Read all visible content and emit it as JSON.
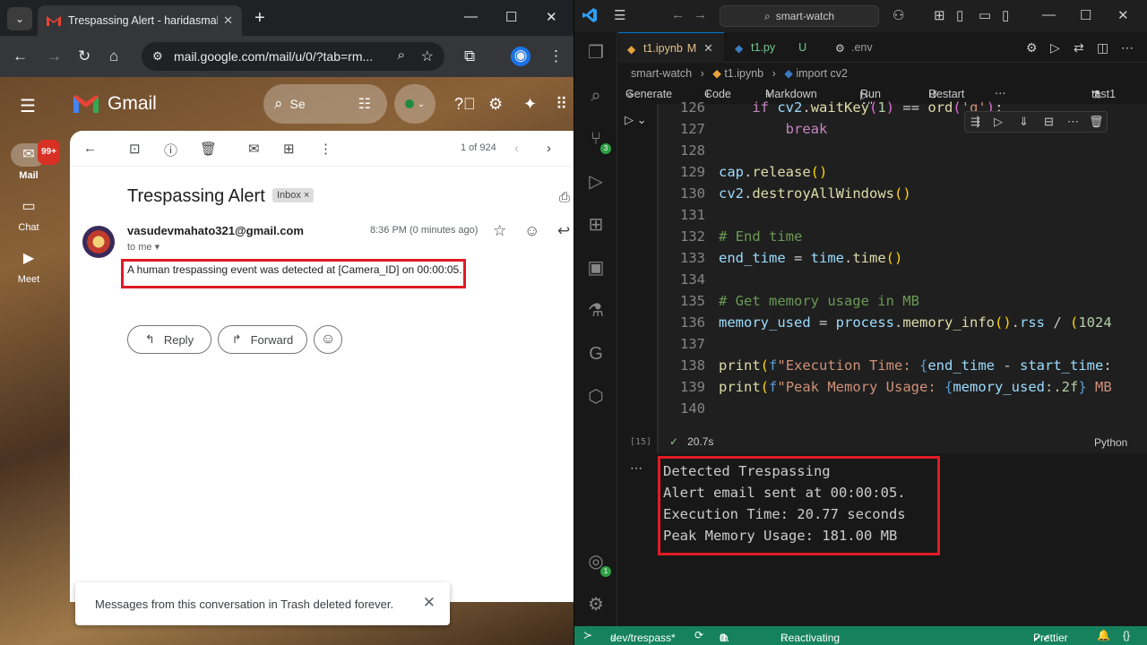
{
  "chrome": {
    "tab_title": "Trespassing Alert - haridasmaha",
    "url": "mail.google.com/mail/u/0/?tab=rm..."
  },
  "gmail": {
    "app_name": "Gmail",
    "search_placeholder": "Se",
    "rail": {
      "mail_label": "Mail",
      "mail_badge": "99+",
      "chat_label": "Chat",
      "meet_label": "Meet"
    },
    "pager": "1 of 924",
    "subject": "Trespassing Alert",
    "label_chip": "Inbox",
    "sender": "vasudevmahato321@gmail.com",
    "to_me": "to me",
    "time": "8:36 PM (0 minutes ago)",
    "body": "A human trespassing event was detected at [Camera_ID] on 00:00:05.",
    "reply_label": "Reply",
    "forward_label": "Forward",
    "toast": "Messages from this conversation in Trash deleted forever."
  },
  "vscode": {
    "command_center": "smart-watch",
    "tabs": [
      {
        "label": "t1.ipynb",
        "status": "M"
      },
      {
        "label": "t1.py",
        "status": "U"
      },
      {
        "label": ".env",
        "status": ""
      }
    ],
    "breadcrumbs": [
      "smart-watch",
      "t1.ipynb",
      "import cv2"
    ],
    "notebook_toolbar": {
      "generate": "Generate",
      "code": "Code",
      "markdown": "Markdown",
      "run_all": "Run All",
      "restart": "Restart",
      "kernel": "test1"
    },
    "code_lines": [
      {
        "n": "126",
        "t": "    if cv2.waitKey(1) == ord('q'):"
      },
      {
        "n": "127",
        "t": "        break"
      },
      {
        "n": "128",
        "t": ""
      },
      {
        "n": "129",
        "t": "cap.release()"
      },
      {
        "n": "130",
        "t": "cv2.destroyAllWindows()"
      },
      {
        "n": "131",
        "t": ""
      },
      {
        "n": "132",
        "t": "# End time"
      },
      {
        "n": "133",
        "t": "end_time = time.time()"
      },
      {
        "n": "134",
        "t": ""
      },
      {
        "n": "135",
        "t": "# Get memory usage in MB"
      },
      {
        "n": "136",
        "t": "memory_used = process.memory_info().rss / (1024"
      },
      {
        "n": "137",
        "t": ""
      },
      {
        "n": "138",
        "t": "print(f\"Execution Time: {end_time - start_time:"
      },
      {
        "n": "139",
        "t": "print(f\"Peak Memory Usage: {memory_used:.2f} MB"
      },
      {
        "n": "140",
        "t": ""
      }
    ],
    "exec_count": "[15]",
    "exec_time": "20.7s",
    "language": "Python",
    "output_lines": [
      "Detected Trespassing",
      "Alert email sent at 00:00:05.",
      "Execution Time: 20.77 seconds",
      "Peak Memory Usage: 181.00 MB"
    ],
    "status": {
      "branch": "dev/trespass*",
      "problems": "0",
      "warnings": "0",
      "message": "Reactivating terminals...",
      "prettier": "Prettier",
      "braces": "{}"
    },
    "activity_badges": {
      "source_control": "3",
      "accounts": "1"
    }
  },
  "colors": {
    "highlight_box": "#e01b24",
    "vs_status_bar": "#16825d",
    "gmail_red": "#ea4335"
  }
}
